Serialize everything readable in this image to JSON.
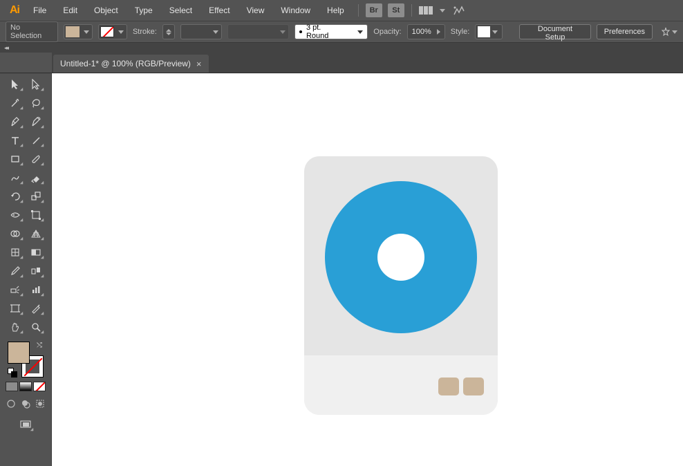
{
  "app_logo": "Ai",
  "menu": {
    "file": "File",
    "edit": "Edit",
    "object": "Object",
    "type": "Type",
    "select": "Select",
    "effect": "Effect",
    "view": "View",
    "window": "Window",
    "help": "Help",
    "br": "Br",
    "st": "St"
  },
  "control": {
    "selection_label": "No Selection",
    "stroke_label": "Stroke:",
    "profile_label": "3 pt. Round",
    "opacity_label": "Opacity:",
    "opacity_value": "100%",
    "style_label": "Style:",
    "doc_setup": "Document Setup",
    "preferences": "Preferences"
  },
  "document": {
    "tab_title": "Untitled-1* @ 100% (RGB/Preview)",
    "tab_close": "×"
  },
  "colors": {
    "fill": "#cbb59a",
    "accent": "#299fd6",
    "canvas_grey": "#e5e5e5"
  }
}
